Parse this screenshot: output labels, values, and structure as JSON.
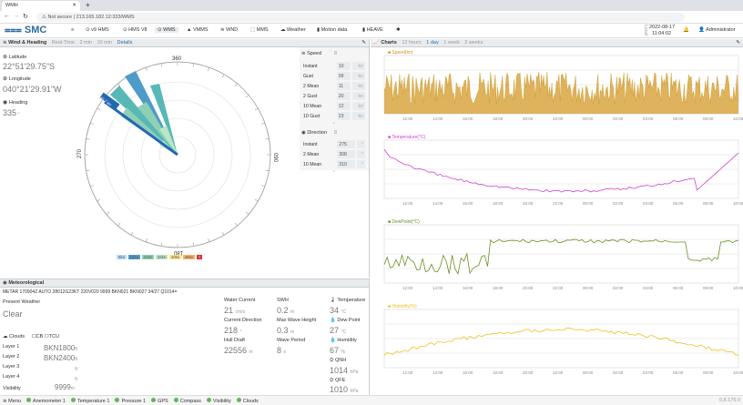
{
  "browser": {
    "tab_title": "WMH",
    "security": "Not secure",
    "url": "213.165.182.12:333/WMS"
  },
  "nav": {
    "brand": "SMC",
    "items": [
      "v9 HMS",
      "HMS V8",
      "WMS",
      "VMMS",
      "WND",
      "MMS",
      "Weather",
      "Motion data",
      "HEAVE"
    ],
    "date_label": "Local",
    "date": "2022-08-17",
    "time": "11:04:02",
    "user": "Administrator"
  },
  "wind": {
    "title": "Wind & Heading",
    "tabs": [
      "Real-Time",
      "2 min",
      "10 min",
      "Details"
    ],
    "latitude_label": "Latitude",
    "latitude": "22°51'29.75\"S",
    "longitude_label": "Longitude",
    "longitude": "040°21'29.91\"W",
    "heading_label": "Heading",
    "heading": "335",
    "speed_label": "Speed",
    "speed_unit_head": "8",
    "speed_rows": [
      [
        "Instant",
        "10",
        "kn"
      ],
      [
        "Gust",
        "09",
        "kn"
      ],
      [
        "2 Mean",
        "11",
        "kn"
      ],
      [
        "2 Gust",
        "20",
        "kn"
      ],
      [
        "10 Mean",
        "12",
        "kn"
      ],
      [
        "10 Gust",
        "23",
        "kn"
      ]
    ],
    "dir_label": "Direction",
    "dir_unit_head": "8",
    "dir_rows": [
      [
        "Instant",
        "275",
        "°"
      ],
      [
        "2 Mean",
        "308",
        "°"
      ],
      [
        "10 Mean",
        "310",
        "°"
      ]
    ],
    "legend": [
      "8kn",
      "16kn",
      "24kn",
      "32kn",
      "40kn",
      "48kn",
      "+"
    ],
    "compass_labels": [
      "360",
      "090",
      "180",
      "270"
    ],
    "arrow_label": "40.7 kn"
  },
  "charts": {
    "title": "Charts",
    "ranges": [
      "12 hours",
      "1 day",
      "1 week",
      "2 weeks"
    ],
    "titles": [
      "Speed(kn)",
      "Temperature(°C)",
      "DewPoint(°C)",
      "Humidity(%)"
    ],
    "time_ticks": [
      "12:00",
      "14:00",
      "16:00",
      "18:00",
      "20:00",
      "22:00",
      "00:00",
      "02:00",
      "04:00",
      "06:00",
      "08:00",
      "10:00"
    ]
  },
  "met": {
    "title": "Meteorological",
    "metar": "METAR 170904Z AUTO 28012G23KT 220V020 9999 BKN021 BKN027 34/27 Q1014=",
    "present_weather_label": "Present Weather",
    "present_weather": "Clear",
    "clouds_label": "Clouds",
    "cb": "CB",
    "tcu": "TCU",
    "layers": [
      [
        "Layer 1",
        "BKN1800"
      ],
      [
        "Layer 2",
        "BKN2400"
      ],
      [
        "Layer 3",
        ""
      ],
      [
        "Layer 4",
        ""
      ]
    ],
    "visibility_label": "Visibility",
    "visibility": "9999",
    "water_current_label": "Water Current",
    "water_current": "21",
    "water_current_unit": "cm/s",
    "current_dir_label": "Current Direction",
    "current_dir": "218",
    "hull_draft_label": "Hull Draft",
    "hull_draft": "22556",
    "swh_label": "SWH",
    "swh": "0.2",
    "max_wave_label": "Max Wave Height",
    "max_wave": "0.3",
    "wave_period_label": "Wave Period",
    "wave_period": "8",
    "temperature_label": "Temperature",
    "temperature": "34",
    "dew_label": "Dew Point",
    "dew": "27",
    "humidity_label": "Humidity",
    "humidity": "67",
    "qnh_label": "QNH",
    "qnh": "1014",
    "qfe_label": "QFE",
    "qfe": "1010"
  },
  "status": {
    "items": [
      "Menu",
      "Anemometer 1",
      "Temperature 1",
      "Pressure 1",
      "GPS",
      "Compass",
      "Visibility",
      "Clouds"
    ],
    "version": "0.8.175.0"
  }
}
